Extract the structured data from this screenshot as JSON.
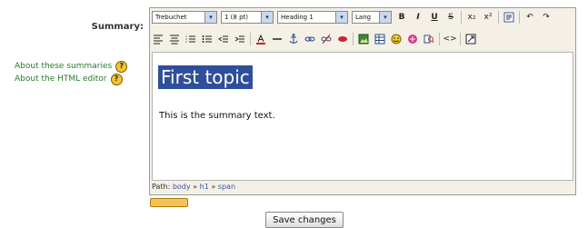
{
  "form": {
    "summary_label": "Summary:"
  },
  "help": {
    "items": [
      {
        "label": "About these summaries"
      },
      {
        "label": "About the HTML editor"
      }
    ]
  },
  "toolbar": {
    "font_family": "Trebuchet",
    "font_size": "1 (8 pt)",
    "paragraph_format": "Heading 1",
    "language": "Lang",
    "bold": "B",
    "italic": "I",
    "underline": "U",
    "strike": "S",
    "subscript": "x₂",
    "superscript": "x²",
    "undo": "↶",
    "redo": "↷"
  },
  "content": {
    "heading": "First topic",
    "body": "This is the summary text."
  },
  "path": {
    "label": "Path:",
    "parts": [
      "body",
      "h1",
      "span"
    ],
    "sep": "»"
  },
  "actions": {
    "save_label": "Save changes"
  }
}
